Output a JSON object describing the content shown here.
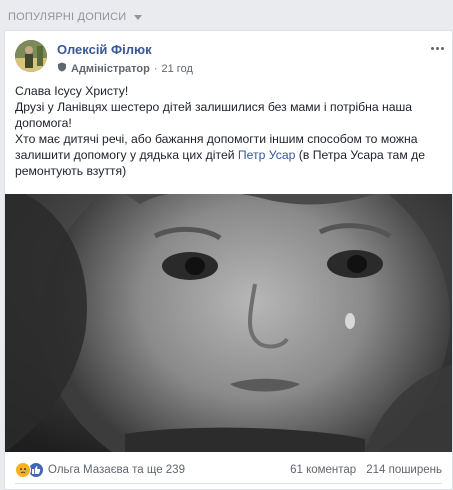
{
  "section": {
    "title": "ПОПУЛЯРНІ ДОПИСИ"
  },
  "post": {
    "author": "Олексій Філюк",
    "role": "Адміністратор",
    "separator": "·",
    "time": "21 год",
    "lines": [
      "Слава Ісусу Христу!",
      "Друзі у Ланівцях шестеро дітей залишилися без мами і потрібна наша допомога!",
      "Хто має дитячі речі, або бажання допомогти іншим способом то можна залишити допомогу у дядька цих дітей "
    ],
    "link_text": "Петр Усар",
    "tail_text": " (в Петра Усара там де ремонтують взуття)"
  },
  "reactions": {
    "summary": "Ольга Мазаєва та ще 239",
    "comments": "61 коментар",
    "shares": "214 поширень"
  },
  "colors": {
    "link": "#365899",
    "meta": "#616770",
    "background": "#e9ebee"
  },
  "icons": [
    "chevron-down-icon",
    "more-icon",
    "admin-badge-icon",
    "sad-reaction-icon",
    "like-reaction-icon"
  ]
}
